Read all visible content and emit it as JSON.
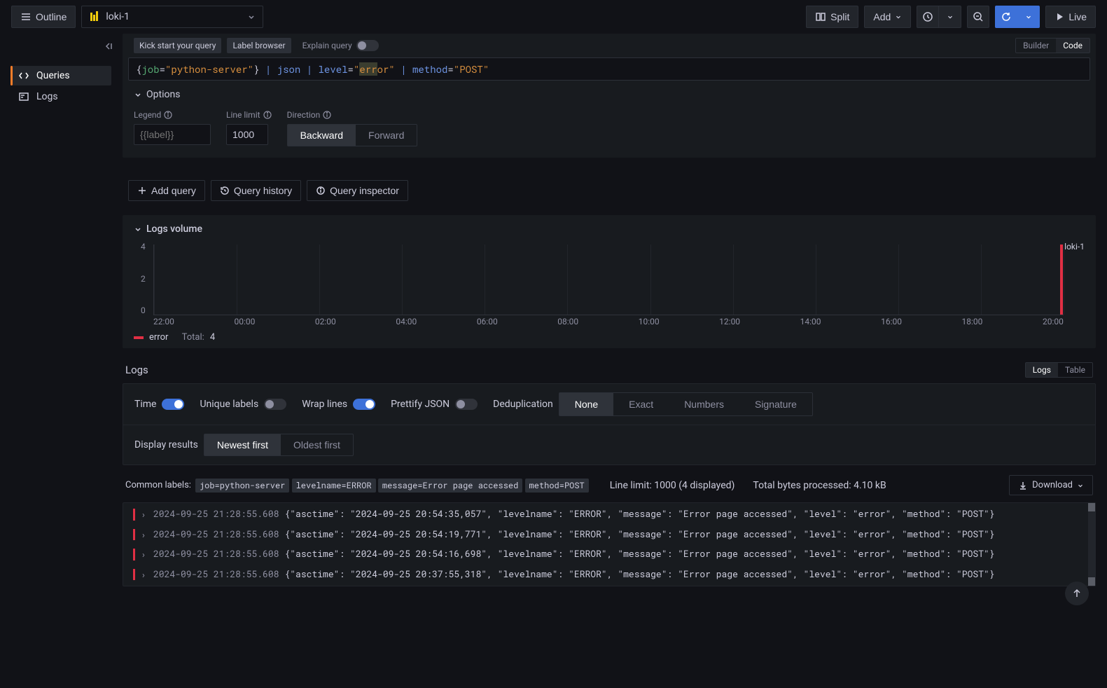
{
  "topbar": {
    "outline_label": "Outline",
    "datasource_name": "loki-1",
    "split_label": "Split",
    "add_label": "Add",
    "live_label": "Live"
  },
  "sidebar": {
    "items": [
      {
        "label": "Queries"
      },
      {
        "label": "Logs"
      }
    ]
  },
  "query_editor": {
    "kick_start": "Kick start your query",
    "label_browser": "Label browser",
    "explain": "Explain query",
    "mode_builder": "Builder",
    "mode_code": "Code",
    "query_tokens": {
      "label": "job",
      "label_val": "\"python-server\"",
      "op1": "json",
      "f1k": "level",
      "f1v": "\"error\"",
      "f2k": "method",
      "f2v": "\"POST\""
    },
    "options_label": "Options",
    "legend_label": "Legend",
    "legend_placeholder": "{{label}}",
    "linelimit_label": "Line limit",
    "linelimit_value": "1000",
    "direction_label": "Direction",
    "direction_backward": "Backward",
    "direction_forward": "Forward"
  },
  "actions": {
    "add_query": "Add query",
    "history": "Query history",
    "inspector": "Query inspector"
  },
  "logs_volume": {
    "title": "Logs volume",
    "series_name": "loki-1",
    "legend_name": "error",
    "legend_total_label": "Total:",
    "legend_total": "4"
  },
  "chart_data": {
    "type": "bar",
    "title": "Logs volume",
    "xlabel": "",
    "ylabel": "",
    "ylim": [
      0,
      4
    ],
    "yticks": [
      0,
      2,
      4
    ],
    "categories": [
      "22:00",
      "00:00",
      "02:00",
      "04:00",
      "06:00",
      "08:00",
      "10:00",
      "12:00",
      "14:00",
      "16:00",
      "18:00",
      "20:00"
    ],
    "series": [
      {
        "name": "error",
        "color": "#e02f44",
        "values": [
          0,
          0,
          0,
          0,
          0,
          0,
          0,
          0,
          0,
          0,
          0,
          4
        ]
      }
    ]
  },
  "logs": {
    "title": "Logs",
    "tab_logs": "Logs",
    "tab_table": "Table",
    "ctl_time": "Time",
    "ctl_unique": "Unique labels",
    "ctl_wrap": "Wrap lines",
    "ctl_prettify": "Prettify JSON",
    "ctl_dedup": "Deduplication",
    "dedup_none": "None",
    "dedup_exact": "Exact",
    "dedup_numbers": "Numbers",
    "dedup_signature": "Signature",
    "ctl_display": "Display results",
    "order_newest": "Newest first",
    "order_oldest": "Oldest first",
    "common_labels_label": "Common labels:",
    "common_labels": [
      "job=python-server",
      "levelname=ERROR",
      "message=Error page accessed",
      "method=POST"
    ],
    "line_limit_label": "Line limit:",
    "line_limit_value": "1000 (4 displayed)",
    "bytes_label": "Total bytes processed:",
    "bytes_value": "4.10 kB",
    "download": "Download",
    "rows": [
      {
        "ts": "2024-09-25 21:28:55.608",
        "msg": "{\"asctime\": \"2024-09-25 20:54:35,057\", \"levelname\": \"ERROR\", \"message\": \"Error page accessed\", \"level\": \"error\", \"method\": \"POST\"}"
      },
      {
        "ts": "2024-09-25 21:28:55.608",
        "msg": "{\"asctime\": \"2024-09-25 20:54:19,771\", \"levelname\": \"ERROR\", \"message\": \"Error page accessed\", \"level\": \"error\", \"method\": \"POST\"}"
      },
      {
        "ts": "2024-09-25 21:28:55.608",
        "msg": "{\"asctime\": \"2024-09-25 20:54:16,698\", \"levelname\": \"ERROR\", \"message\": \"Error page accessed\", \"level\": \"error\", \"method\": \"POST\"}"
      },
      {
        "ts": "2024-09-25 21:28:55.608",
        "msg": "{\"asctime\": \"2024-09-25 20:37:55,318\", \"levelname\": \"ERROR\", \"message\": \"Error page accessed\", \"level\": \"error\", \"method\": \"POST\"}"
      }
    ]
  }
}
